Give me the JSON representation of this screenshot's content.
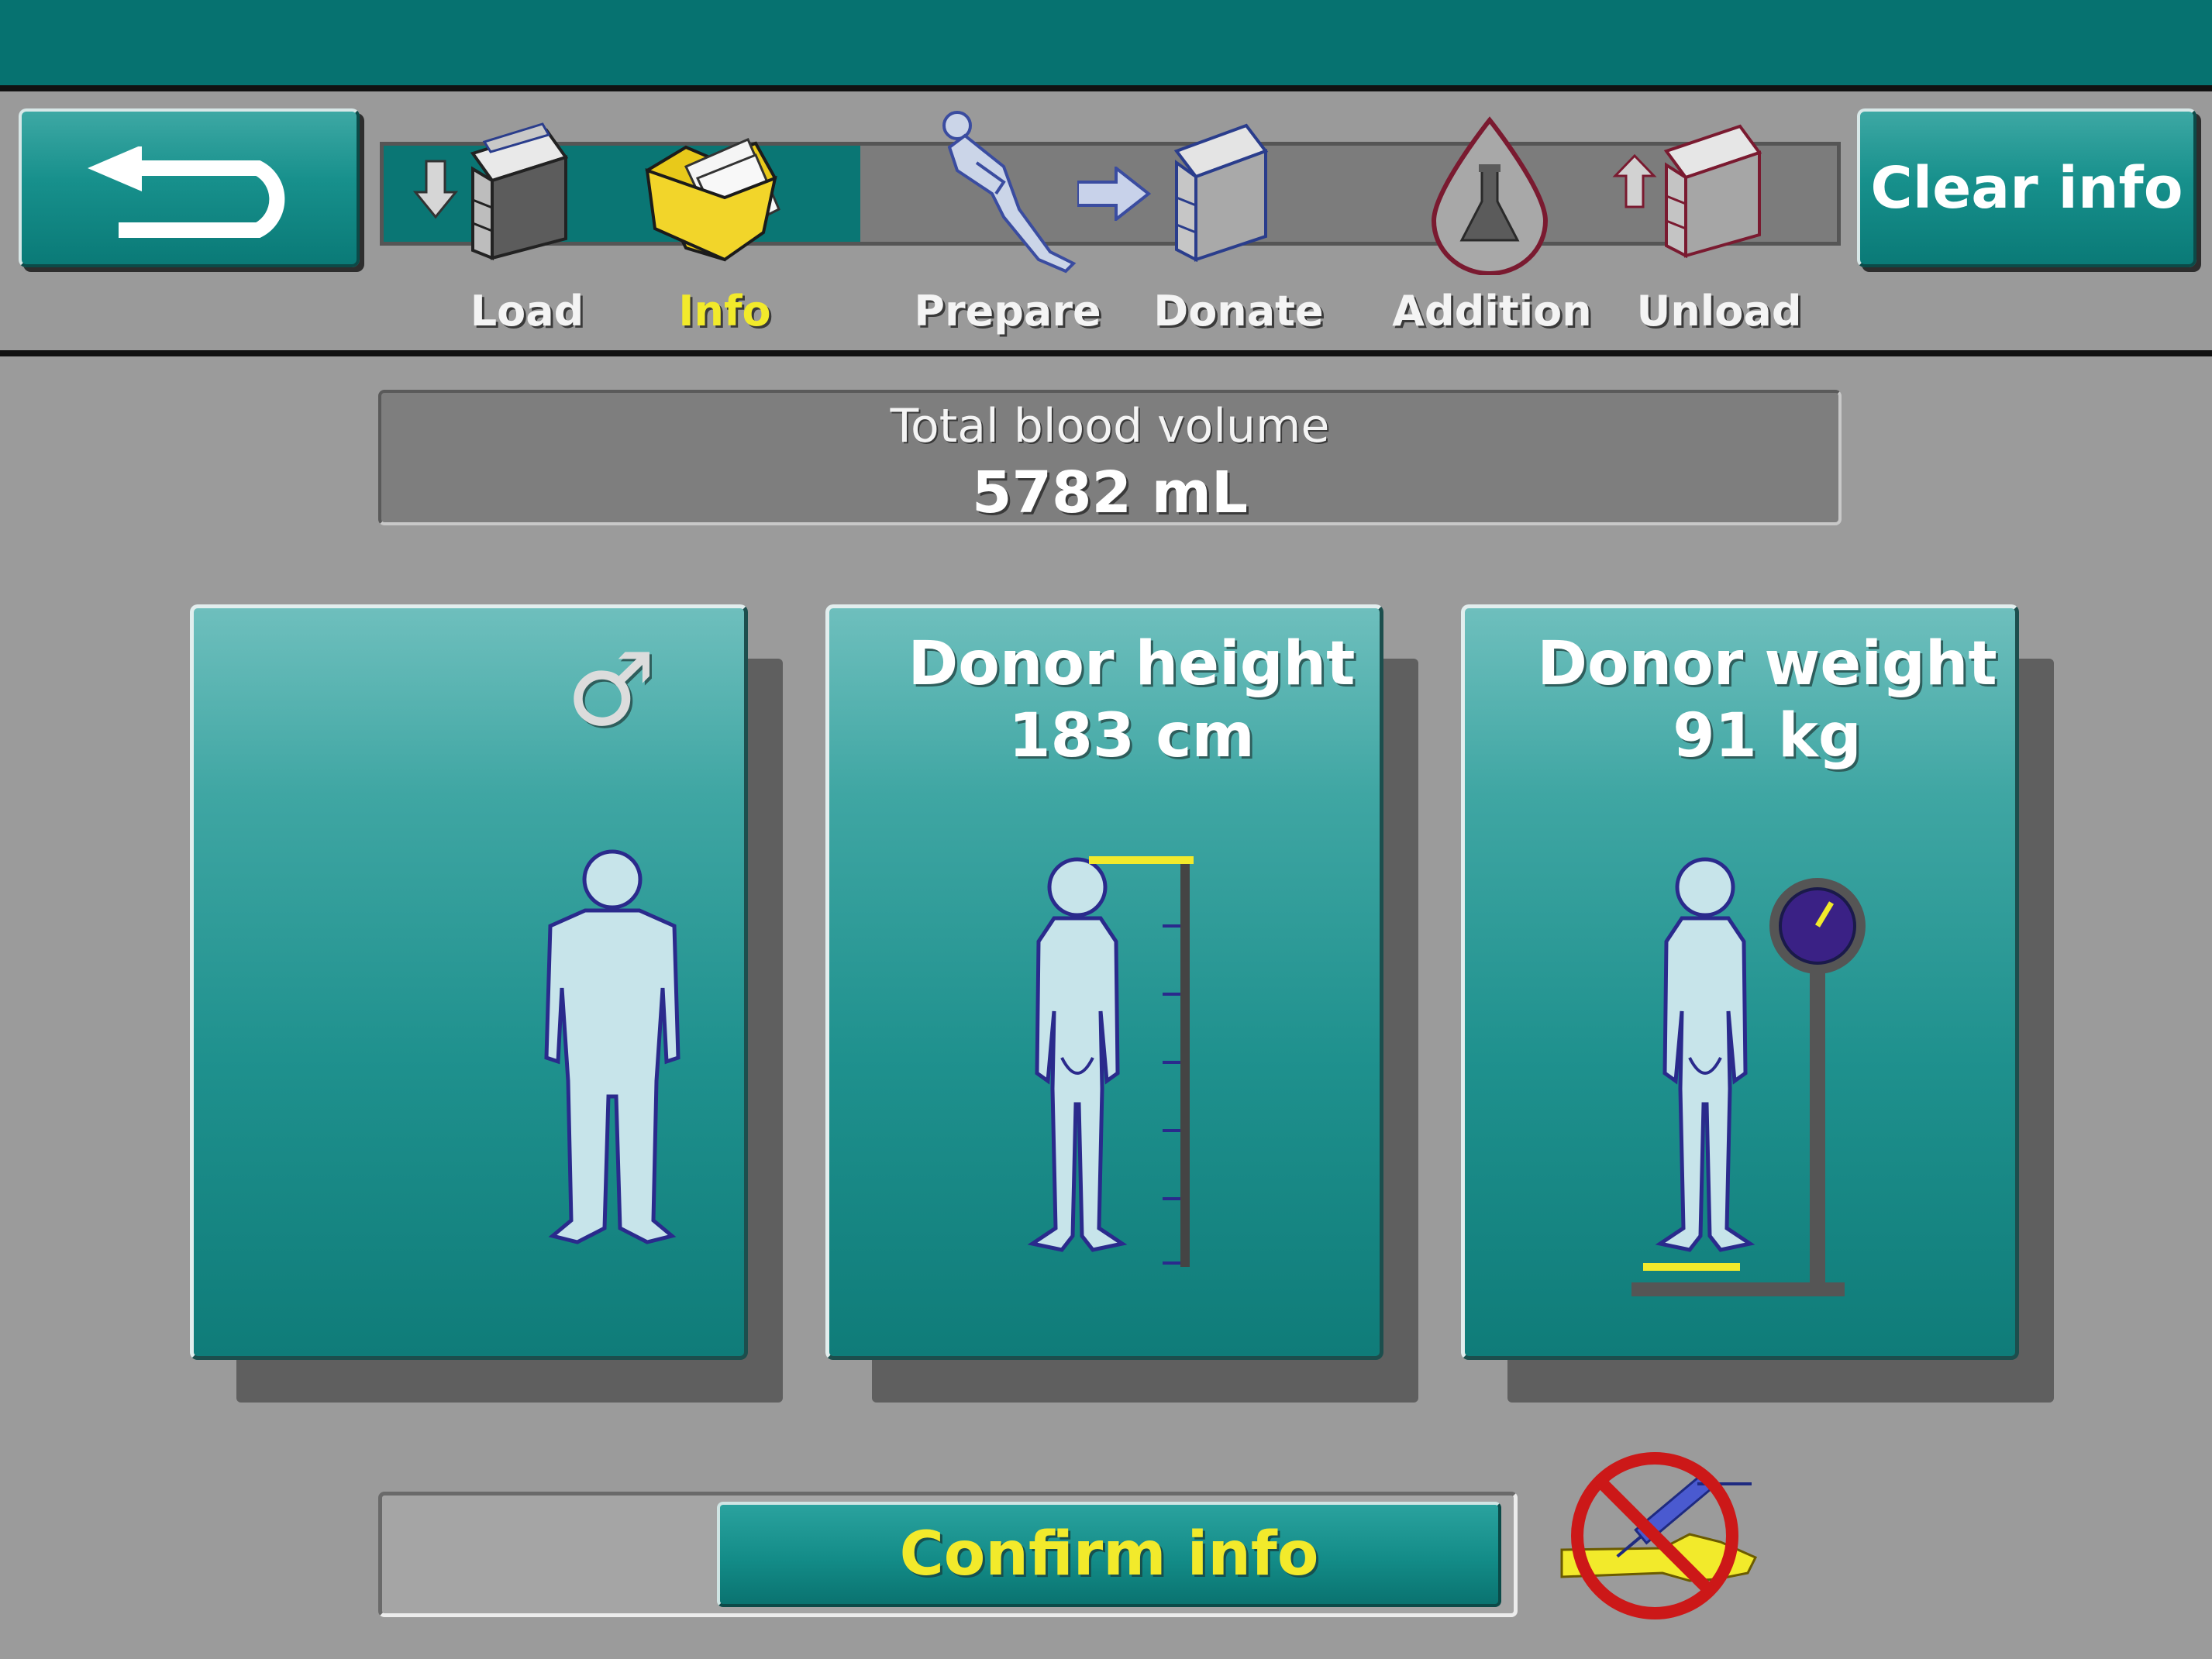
{
  "toolbar": {
    "clear_label": "Clear info",
    "steps": [
      {
        "label": "Load",
        "icon": "load-machine-icon",
        "state": "done"
      },
      {
        "label": "Info",
        "icon": "folder-icon",
        "state": "active"
      },
      {
        "label": "Prepare",
        "icon": "patient-reclined-icon",
        "state": "pending"
      },
      {
        "label": "Donate",
        "icon": "donate-machine-icon",
        "state": "pending"
      },
      {
        "label": "Addition",
        "icon": "blood-drop-flask-icon",
        "state": "pending"
      },
      {
        "label": "Unload",
        "icon": "unload-machine-icon",
        "state": "pending"
      }
    ]
  },
  "summary": {
    "label": "Total blood volume",
    "value": "5782 mL"
  },
  "panels": {
    "gender": {
      "symbol": "♂",
      "icon": "male-icon"
    },
    "height": {
      "title": "Donor height",
      "value": "183 cm"
    },
    "weight": {
      "title": "Donor weight",
      "value": "91 kg"
    }
  },
  "footer": {
    "confirm_label": "Confirm info",
    "status_icon": "no-needle-arm-icon"
  },
  "colors": {
    "teal": "#067270",
    "active_yellow": "#f2ea2b",
    "background": "#9b9b9b"
  }
}
